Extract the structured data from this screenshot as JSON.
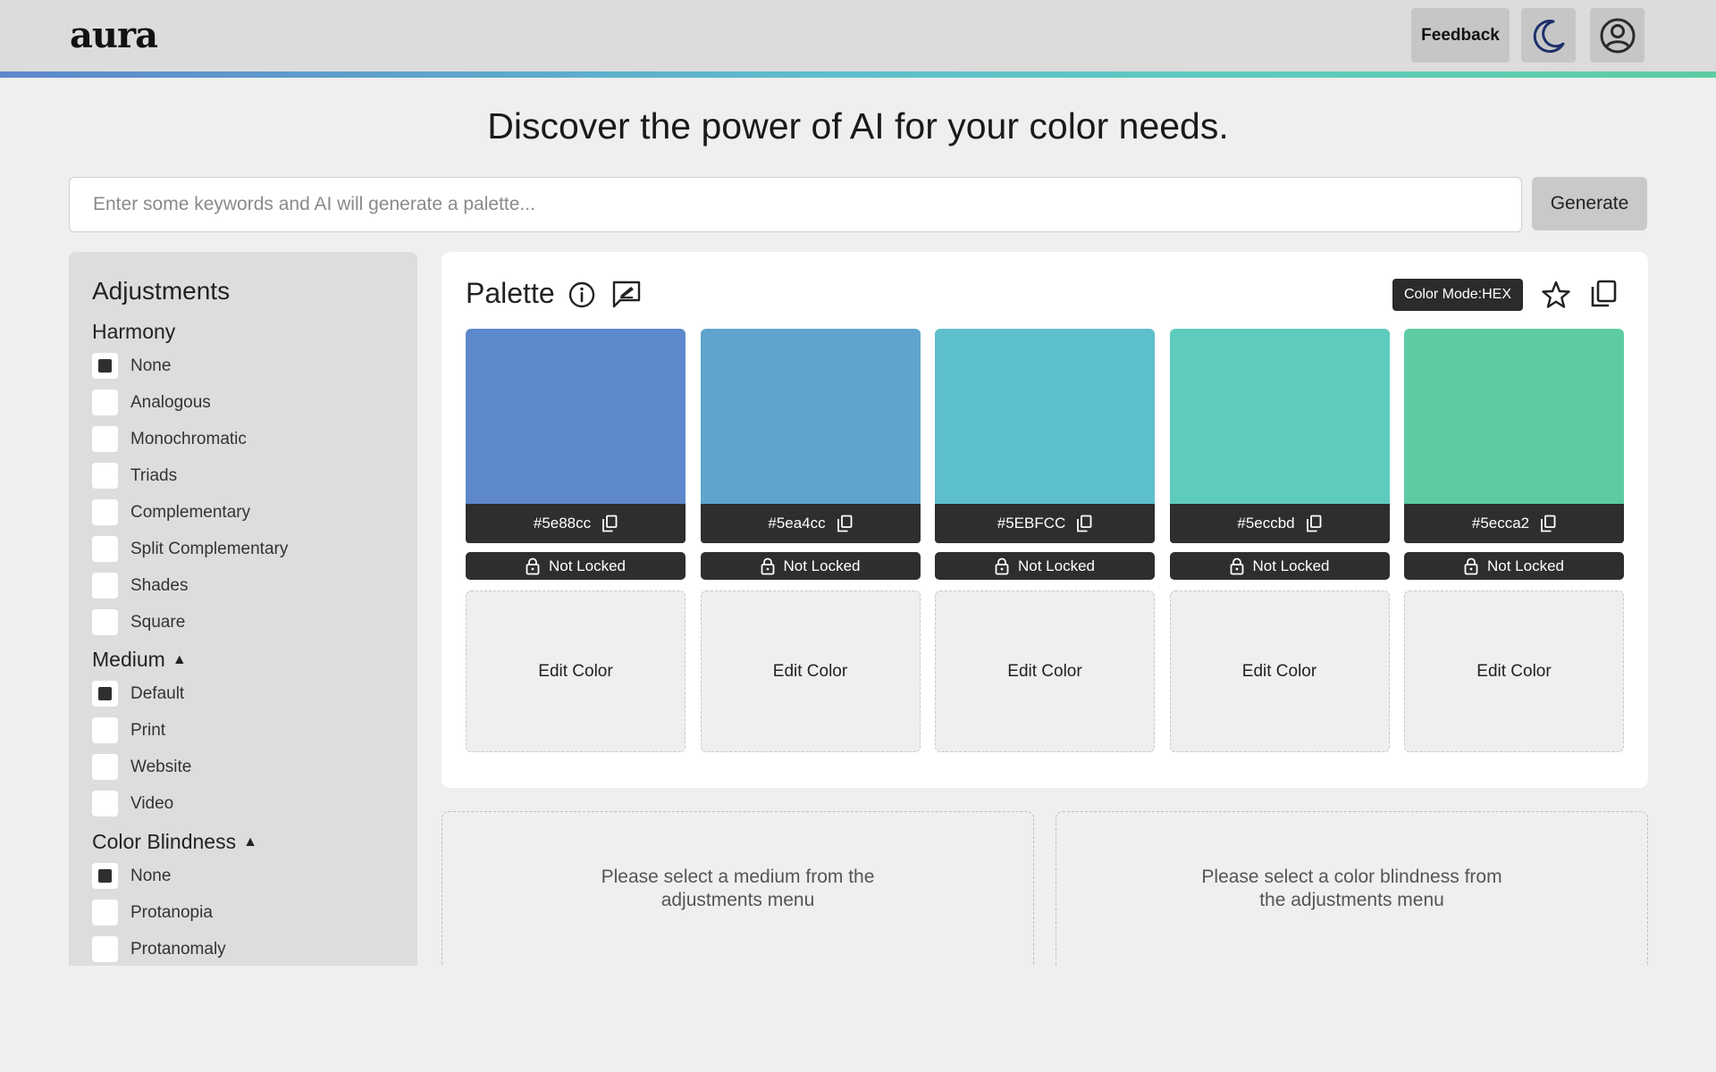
{
  "header": {
    "logo": "aura",
    "feedback_label": "Feedback"
  },
  "headline": "Discover the power of AI for your color needs.",
  "search": {
    "placeholder": "Enter some keywords and AI will generate a palette...",
    "value": "",
    "generate_label": "Generate"
  },
  "sidebar": {
    "title": "Adjustments",
    "harmony": {
      "heading": "Harmony",
      "options": [
        {
          "label": "None",
          "checked": true
        },
        {
          "label": "Analogous",
          "checked": false
        },
        {
          "label": "Monochromatic",
          "checked": false
        },
        {
          "label": "Triads",
          "checked": false
        },
        {
          "label": "Complementary",
          "checked": false
        },
        {
          "label": "Split Complementary",
          "checked": false
        },
        {
          "label": "Shades",
          "checked": false
        },
        {
          "label": "Square",
          "checked": false
        }
      ]
    },
    "medium": {
      "heading": "Medium",
      "arrow": "▲",
      "options": [
        {
          "label": "Default",
          "checked": true
        },
        {
          "label": "Print",
          "checked": false
        },
        {
          "label": "Website",
          "checked": false
        },
        {
          "label": "Video",
          "checked": false
        }
      ]
    },
    "color_blindness": {
      "heading": "Color Blindness",
      "arrow": "▲",
      "options": [
        {
          "label": "None",
          "checked": true
        },
        {
          "label": "Protanopia",
          "checked": false
        },
        {
          "label": "Protanomaly",
          "checked": false
        }
      ]
    }
  },
  "palette": {
    "title": "Palette",
    "color_mode": "Color Mode:HEX",
    "colors": [
      {
        "hex": "#5e88cc",
        "swatch": "#5e88cc",
        "lock_label": "Not Locked",
        "edit_label": "Edit Color"
      },
      {
        "hex": "#5ea4cc",
        "swatch": "#5ea4cc",
        "lock_label": "Not Locked",
        "edit_label": "Edit Color"
      },
      {
        "hex": "#5EBFCC",
        "swatch": "#5ebfcc",
        "lock_label": "Not Locked",
        "edit_label": "Edit Color"
      },
      {
        "hex": "#5eccbd",
        "swatch": "#5eccbd",
        "lock_label": "Not Locked",
        "edit_label": "Edit Color"
      },
      {
        "hex": "#5ecca2",
        "swatch": "#5ecca2",
        "lock_label": "Not Locked",
        "edit_label": "Edit Color"
      }
    ]
  },
  "info": {
    "medium_message": "Please select a medium from the adjustments menu",
    "blindness_message": "Please select a color blindness from the adjustments menu"
  },
  "icons": {
    "theme": "moon-icon",
    "account": "user-circle-icon",
    "info": "info-icon",
    "comment": "comment-icon",
    "favorite": "star-icon",
    "copy": "copy-icon",
    "lock": "lock-icon"
  }
}
